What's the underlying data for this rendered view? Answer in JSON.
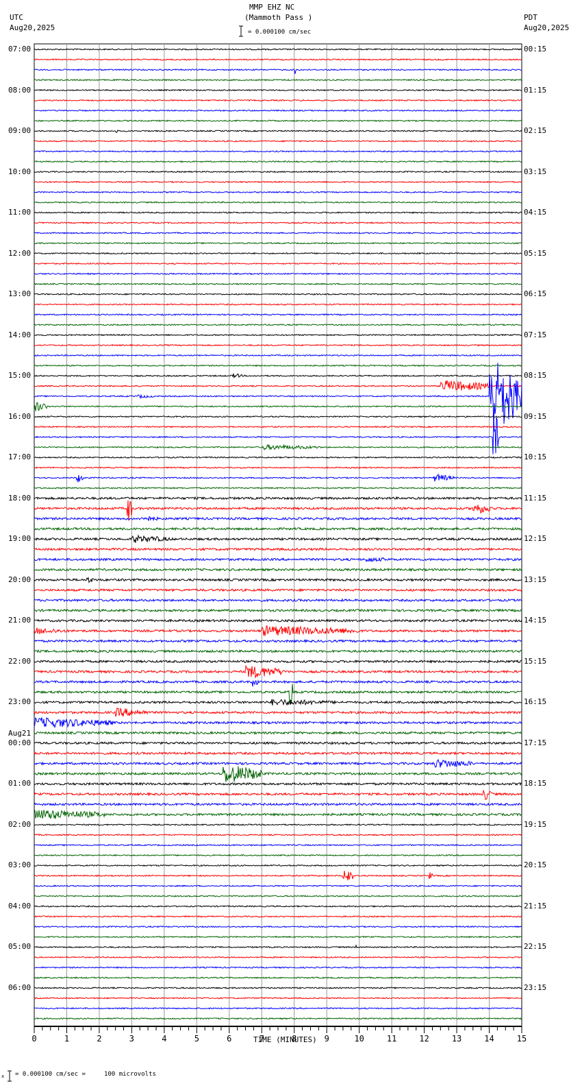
{
  "header": {
    "title": "MMP EHZ NC",
    "subtitle": "(Mammoth Pass )",
    "scale_text": "= 0.000100 cm/sec",
    "left_tz": "UTC",
    "left_date": "Aug20,2025",
    "right_tz": "PDT",
    "right_date": "Aug20,2025"
  },
  "footer": {
    "scale_text": "= 0.000100 cm/sec =     100 microvolts",
    "prefix": "x"
  },
  "chart_data": {
    "type": "line",
    "title": "MMP EHZ NC (Mammoth Pass )",
    "xlabel": "TIME (MINUTES)",
    "xlim": [
      0,
      15
    ],
    "xticks": [
      "0",
      "1",
      "2",
      "3",
      "4",
      "5",
      "6",
      "7",
      "8",
      "9",
      "10",
      "11",
      "12",
      "13",
      "14",
      "15"
    ],
    "trace_colors": [
      "#000000",
      "#ff0000",
      "#0000ff",
      "#006400"
    ],
    "traces_per_hour": 4,
    "left_labels": [
      "07:00",
      "08:00",
      "09:00",
      "10:00",
      "11:00",
      "12:00",
      "13:00",
      "14:00",
      "15:00",
      "16:00",
      "17:00",
      "18:00",
      "19:00",
      "20:00",
      "21:00",
      "22:00",
      "23:00",
      "00:00",
      "01:00",
      "02:00",
      "03:00",
      "04:00",
      "05:00",
      "06:00"
    ],
    "date_change_label": "Aug21",
    "date_change_hour_index": 17,
    "right_labels": [
      "00:15",
      "01:15",
      "02:15",
      "03:15",
      "04:15",
      "05:15",
      "06:15",
      "07:15",
      "08:15",
      "09:15",
      "10:15",
      "11:15",
      "12:15",
      "13:15",
      "14:15",
      "15:15",
      "16:15",
      "17:15",
      "18:15",
      "19:15",
      "20:15",
      "21:15",
      "22:15",
      "23:15"
    ],
    "events": [
      {
        "trace": 2,
        "minute": 8.0,
        "duration": 0.1,
        "amp": 10
      },
      {
        "trace": 8,
        "minute": 2.5,
        "duration": 0.1,
        "amp": 3
      },
      {
        "trace": 32,
        "minute": 6.1,
        "duration": 0.3,
        "amp": 4
      },
      {
        "trace": 33,
        "minute": 12.5,
        "duration": 1.5,
        "amp": 9
      },
      {
        "trace": 34,
        "minute": 14.0,
        "duration": 1.0,
        "amp": 60
      },
      {
        "trace": 34,
        "minute": 3.2,
        "duration": 0.5,
        "amp": 3
      },
      {
        "trace": 35,
        "minute": 0.0,
        "duration": 0.4,
        "amp": 8
      },
      {
        "trace": 38,
        "minute": 14.1,
        "duration": 0.2,
        "amp": 45
      },
      {
        "trace": 39,
        "minute": 7.0,
        "duration": 1.8,
        "amp": 4
      },
      {
        "trace": 42,
        "minute": 1.3,
        "duration": 0.2,
        "amp": 8
      },
      {
        "trace": 42,
        "minute": 12.3,
        "duration": 0.6,
        "amp": 6
      },
      {
        "trace": 45,
        "minute": 2.85,
        "duration": 0.15,
        "amp": 25
      },
      {
        "trace": 45,
        "minute": 13.5,
        "duration": 0.6,
        "amp": 9
      },
      {
        "trace": 46,
        "minute": 3.3,
        "duration": 0.5,
        "amp": 5
      },
      {
        "trace": 48,
        "minute": 3.0,
        "duration": 1.2,
        "amp": 6
      },
      {
        "trace": 50,
        "minute": 10.2,
        "duration": 0.8,
        "amp": 4
      },
      {
        "trace": 52,
        "minute": 1.6,
        "duration": 0.3,
        "amp": 5
      },
      {
        "trace": 57,
        "minute": 7.0,
        "duration": 3.0,
        "amp": 8
      },
      {
        "trace": 57,
        "minute": 0.0,
        "duration": 1.0,
        "amp": 5
      },
      {
        "trace": 61,
        "minute": 6.5,
        "duration": 1.2,
        "amp": 10
      },
      {
        "trace": 62,
        "minute": 6.7,
        "duration": 0.2,
        "amp": 8
      },
      {
        "trace": 63,
        "minute": 7.85,
        "duration": 0.1,
        "amp": 35
      },
      {
        "trace": 64,
        "minute": 7.3,
        "duration": 2.0,
        "amp": 5
      },
      {
        "trace": 65,
        "minute": 2.5,
        "duration": 1.0,
        "amp": 7
      },
      {
        "trace": 66,
        "minute": 0.0,
        "duration": 2.5,
        "amp": 8
      },
      {
        "trace": 70,
        "minute": 12.3,
        "duration": 1.2,
        "amp": 7
      },
      {
        "trace": 71,
        "minute": 5.8,
        "duration": 1.2,
        "amp": 15
      },
      {
        "trace": 73,
        "minute": 13.8,
        "duration": 0.3,
        "amp": 10
      },
      {
        "trace": 75,
        "minute": 0.0,
        "duration": 2.2,
        "amp": 8
      },
      {
        "trace": 81,
        "minute": 9.5,
        "duration": 0.3,
        "amp": 12
      },
      {
        "trace": 81,
        "minute": 12.15,
        "duration": 0.1,
        "amp": 6
      },
      {
        "trace": 88,
        "minute": 9.9,
        "duration": 0.05,
        "amp": 5
      }
    ]
  }
}
